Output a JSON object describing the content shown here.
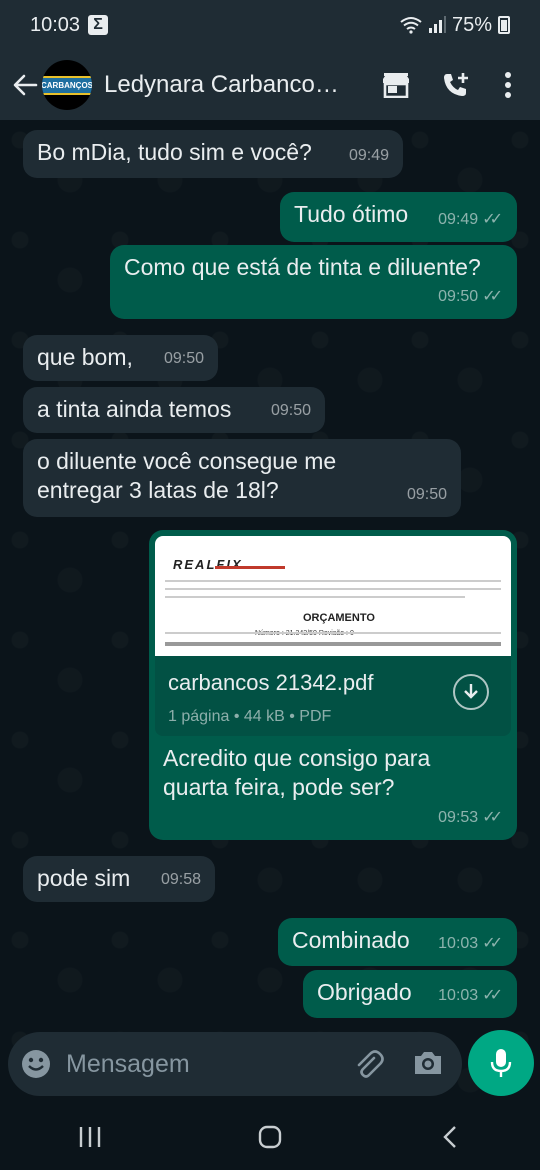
{
  "status_bar": {
    "time": "10:03",
    "battery": "75%"
  },
  "header": {
    "contact_name": "Ledynara Carbancos...",
    "avatar_text": "CARBANÇOS"
  },
  "messages": [
    {
      "dir": "in",
      "text": "Bo mDia, tudo sim e você?",
      "time": "09:49"
    },
    {
      "dir": "out",
      "text": "Tudo ótimo",
      "time": "09:49"
    },
    {
      "dir": "out",
      "text": "Como que está de tinta e diluente?",
      "time": "09:50"
    },
    {
      "dir": "in",
      "text": "que bom,",
      "time": "09:50"
    },
    {
      "dir": "in",
      "text": "a tinta ainda temos",
      "time": "09:50"
    },
    {
      "dir": "in",
      "text": "o diluente você consegue me entregar 3 latas de 18l?",
      "time": "09:50"
    },
    {
      "dir": "out",
      "text": "Acredito que consigo para quarta feira, pode ser?",
      "time": "09:53",
      "document": {
        "brand": "REALFIX",
        "heading": "ORÇAMENTO",
        "numero": "Número :  21.342/50      Revisão :   0",
        "name": "carbancos 21342.pdf",
        "details": "1 página • 44 kB • PDF"
      }
    },
    {
      "dir": "in",
      "text": "pode sim",
      "time": "09:58"
    },
    {
      "dir": "out",
      "text": "Combinado",
      "time": "10:03"
    },
    {
      "dir": "out",
      "text": "Obrigado",
      "time": "10:03"
    }
  ],
  "composer": {
    "placeholder": "Mensagem"
  },
  "colors": {
    "incoming": "#1f2c34",
    "outgoing": "#005c4b",
    "accent": "#00a884",
    "background": "#0b141a"
  }
}
